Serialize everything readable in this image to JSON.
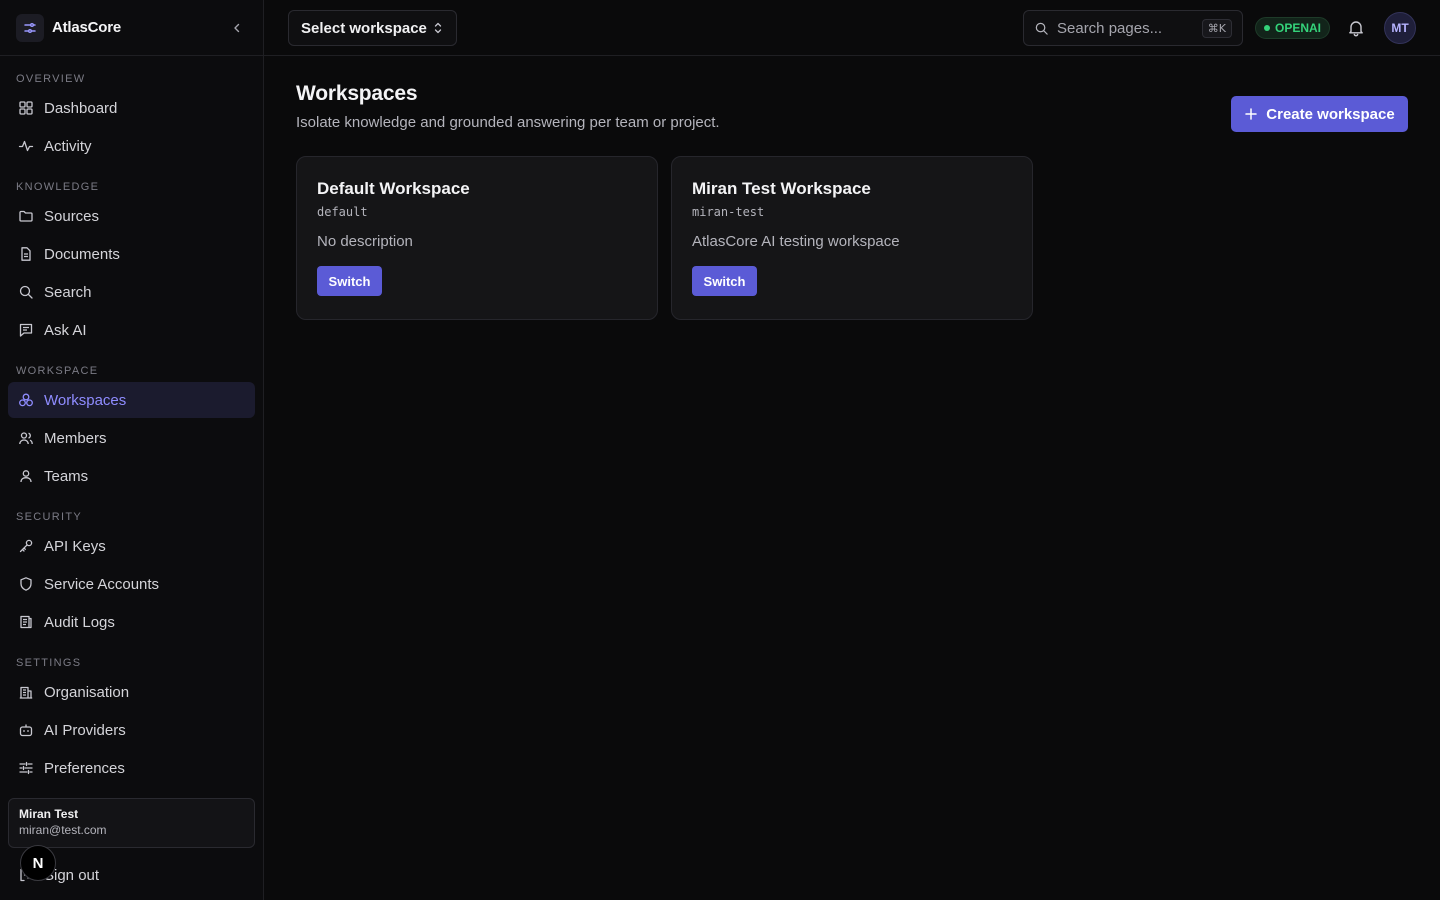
{
  "brand": {
    "name": "AtlasCore"
  },
  "sidebar": {
    "sections": [
      {
        "label": "OVERVIEW",
        "items": [
          {
            "label": "Dashboard",
            "icon": "dashboard-icon"
          },
          {
            "label": "Activity",
            "icon": "activity-icon"
          }
        ]
      },
      {
        "label": "KNOWLEDGE",
        "items": [
          {
            "label": "Sources",
            "icon": "folder-icon"
          },
          {
            "label": "Documents",
            "icon": "document-icon"
          },
          {
            "label": "Search",
            "icon": "search-icon"
          },
          {
            "label": "Ask AI",
            "icon": "chat-icon"
          }
        ]
      },
      {
        "label": "WORKSPACE",
        "items": [
          {
            "label": "Workspaces",
            "icon": "workspaces-icon",
            "active": true
          },
          {
            "label": "Members",
            "icon": "members-icon"
          },
          {
            "label": "Teams",
            "icon": "team-icon"
          }
        ]
      },
      {
        "label": "SECURITY",
        "items": [
          {
            "label": "API Keys",
            "icon": "key-icon"
          },
          {
            "label": "Service Accounts",
            "icon": "shield-icon"
          },
          {
            "label": "Audit Logs",
            "icon": "audit-log-icon"
          }
        ]
      },
      {
        "label": "SETTINGS",
        "items": [
          {
            "label": "Organisation",
            "icon": "building-icon"
          },
          {
            "label": "AI Providers",
            "icon": "bot-icon"
          },
          {
            "label": "Preferences",
            "icon": "sliders-icon"
          }
        ]
      }
    ]
  },
  "user": {
    "name": "Miran Test",
    "email": "miran@test.com",
    "initials": "MT"
  },
  "signout_label": "Sign out",
  "n_badge": "N",
  "topbar": {
    "workspace_select": "Select workspace",
    "search_placeholder": "Search pages...",
    "search_shortcut": "⌘K",
    "provider_badge": "OPENAI"
  },
  "main": {
    "title": "Workspaces",
    "subtitle": "Isolate knowledge and grounded answering per team or project.",
    "create_label": "Create workspace",
    "workspaces": [
      {
        "name": "Default Workspace",
        "slug": "default",
        "description": "No description",
        "action": "Switch"
      },
      {
        "name": "Miran Test Workspace",
        "slug": "miran-test",
        "description": "AtlasCore AI testing workspace",
        "action": "Switch"
      }
    ]
  },
  "colors": {
    "accent": "#5b5bd6",
    "active_text": "#8f8cff",
    "success": "#34d37a",
    "background": "#0a0a0b"
  }
}
